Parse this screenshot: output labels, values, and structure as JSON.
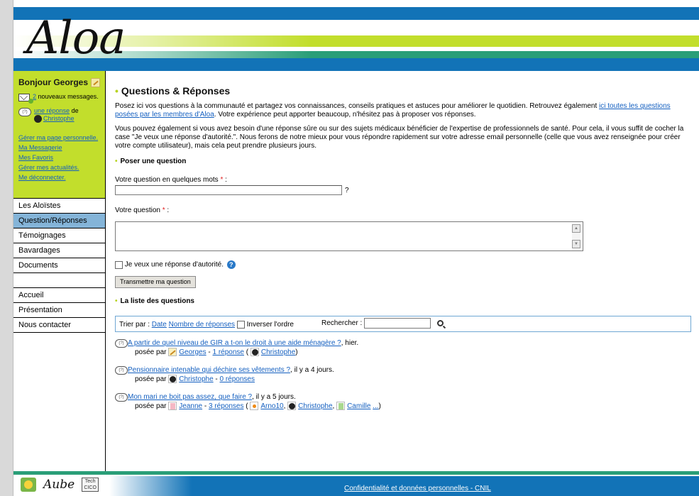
{
  "site": {
    "logo_text": "Aloa"
  },
  "user_panel": {
    "greeting": "Bonjour Georges",
    "messages_count": "2",
    "messages_text": "nouveaux messages.",
    "reply_link": "une réponse",
    "reply_de": "de",
    "reply_author": "Christophe",
    "links": [
      "Gérer ma page personnelle.",
      "Ma Messagerie",
      "Mes Favoris",
      "Gérer mes actualités.",
      "Me déconnecter."
    ]
  },
  "nav": {
    "items": [
      "Les Aloïstes",
      "Question/Réponses",
      "Témoignages",
      "Bavardages",
      "Documents"
    ],
    "items2": [
      "Accueil",
      "Présentation",
      "Nous contacter"
    ],
    "active_index": 1
  },
  "main": {
    "title": "Questions & Réponses",
    "intro_1": "Posez ici vos questions à la communauté et partagez vos connaissances, conseils pratiques et astuces pour améliorer le quotidien. Retrouvez également",
    "intro_link": "ici toutes les questions posées par les membres d'Aloa",
    "intro_2": ". Votre expérience peut apporter beaucoup, n'hésitez pas à proposer vos réponses.",
    "intro_3": "Vous pouvez également si vous avez besoin d'une réponse sûre ou sur des sujets médicaux bénéficier de l'expertise de professionnels de santé. Pour cela, il vous suffit de cocher la case \"Je veux une réponse d'autorité.\". Nous ferons de notre mieux pour vous répondre rapidement sur votre adresse email personnelle (celle que vous avez renseignée pour créer votre compte utilisateur), mais cela peut prendre plusieurs jours.",
    "ask_heading": "Poser une question",
    "short_label": "Votre question en quelques mots",
    "short_value": "",
    "help_mark": "?",
    "long_label": "Votre question",
    "long_value": "",
    "authority_label": "Je veux une réponse d'autorité.",
    "submit_label": "Transmettre ma question",
    "list_heading": "La liste des questions"
  },
  "filter": {
    "sort_label": "Trier par :",
    "sort_date": "Date",
    "sort_count": "Nombre de réponses",
    "reverse_label": "Inverser l'ordre",
    "search_label": "Rechercher :",
    "search_value": ""
  },
  "questions": [
    {
      "title": "A partir de quel niveau de GIR a t-on le droit à une aide ménagère ?",
      "when": ", hier.",
      "posed_by": "posée par",
      "author": "Georges",
      "replies": "1 réponse",
      "responders": [
        "Christophe"
      ]
    },
    {
      "title": "Pensionnaire intenable qui déchire ses vêtements ?",
      "when": ", il y a 4 jours.",
      "posed_by": "posée par",
      "author": "Christophe",
      "replies": "0 réponses",
      "responders": []
    },
    {
      "title": "Mon mari ne boit pas assez, que faire ?",
      "when": ", il y a 5 jours.",
      "posed_by": "posée par",
      "author": "Jeanne",
      "replies": "3 réponses",
      "responders": [
        "Arno10",
        "Christophe",
        "Camille"
      ],
      "more": "..."
    }
  ],
  "footer": {
    "link": "Confidentialité et données personnelles - CNIL",
    "logo_aube": "Aube",
    "logo_tech": "Tech CICO"
  },
  "colors": {
    "lime": "#c2de2c",
    "blue": "#1273b7",
    "teal": "#2a9e78",
    "active_nav": "#84b4d8"
  }
}
